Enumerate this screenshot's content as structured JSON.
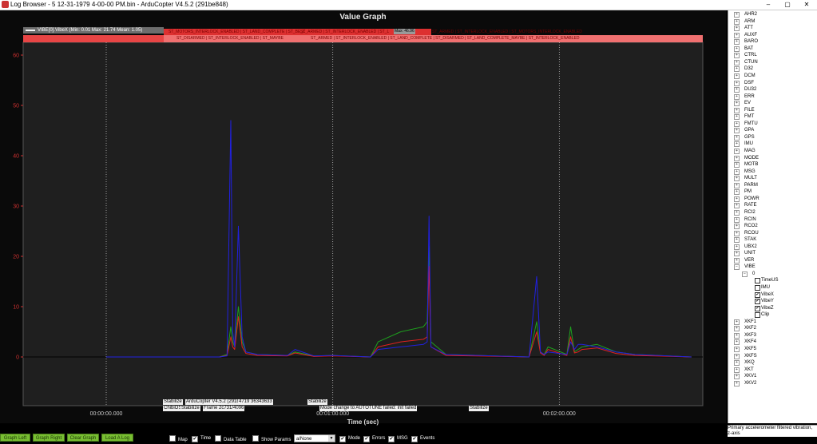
{
  "window": {
    "title": "Log Browser - 5 12-31-1979 4-00-00 PM.bin - ArduCopter V4.5.2 (291be848)",
    "minimize": "–",
    "maximize": "▢",
    "close": "✕"
  },
  "graph": {
    "title": "Value Graph",
    "legend": "VIBE[0].VibeX  (Min: 0.01 Max: 21.74 Mean: 1.05)",
    "x_axis_label": "Time (sec)",
    "x_ticks": [
      "00:00:00.000",
      "00:01:00.000",
      "00:02:00.000"
    ],
    "y_ticks": [
      "0",
      "10",
      "20",
      "30",
      "40",
      "50",
      "60"
    ],
    "top_bar_snippets": [
      "ST_MOTORS_INTERLOCK_ENABLED | ST_LAND_COMPLETE | ST_BE_DISARMED",
      "ST_ARMED | ST_INTERLOCK_ENABLED | ST_LAND_COMPLETE_MAYBE",
      "ST_ARMED | ST_INTERLOCK_ENABLED | ST_MOTORS_INTERLOCK_ENABLED",
      "ST_DISARMED | ST_INTERLOCK_ENABLED | ST_MAYBE",
      "ST_ARMED | ST_INTERLOCK_ENABLED | ST_LAND_COMPLETE | ST_DISARMED | ST_LAND_COMPLETE_MAYBE | ST_INTERLOCK_ENABLED"
    ],
    "mid_bar_overlay": "Max: 46.96",
    "annotations": {
      "a1": "Stabilize",
      "a2": "ArduCopter V4.5.2 (291be848)",
      "a3": "4719 36343633",
      "a4": "ChibiOS",
      "a5": "Stabilize",
      "a6": "Frame",
      "a7": "2c731/4096",
      "a8": "Stabilize",
      "a9": "Mode change to AUTOTUNE failed: init failed",
      "a10": "Stabilize"
    }
  },
  "chart_data": {
    "type": "line",
    "xlabel": "Time (sec)",
    "ylabel": "",
    "ylim": [
      0,
      60
    ],
    "x_tick_labels": [
      "00:00:00.000",
      "00:01:00.000",
      "00:02:00.000"
    ],
    "series": [
      {
        "name": "VIBE[0].VibeX",
        "color": "#1fa01f",
        "x": [
          0,
          30,
          32,
          33,
          33.5,
          34,
          35,
          36,
          37,
          40,
          48,
          50,
          55,
          60,
          70,
          72,
          78,
          84,
          85,
          85.5,
          86,
          90,
          112,
          114,
          115,
          116,
          117,
          122,
          123,
          124,
          125,
          126,
          130,
          135,
          140,
          155
        ],
        "y": [
          0,
          0,
          0.5,
          6,
          3,
          2,
          10,
          3,
          1,
          0.5,
          0.3,
          1,
          0.2,
          0.3,
          0,
          3,
          5,
          6,
          7,
          22,
          3,
          0.5,
          0,
          7,
          1,
          0.5,
          2,
          0.5,
          6,
          1,
          1.5,
          2,
          2.5,
          1,
          0.5,
          0
        ]
      },
      {
        "name": "VIBE[0].VibeY",
        "color": "#e02020",
        "x": [
          0,
          30,
          32,
          33,
          33.5,
          34,
          35,
          36,
          37,
          40,
          48,
          50,
          55,
          60,
          70,
          72,
          78,
          84,
          85,
          85.5,
          86,
          90,
          112,
          114,
          115,
          116,
          117,
          122,
          123,
          124,
          125,
          126,
          130,
          135,
          140,
          155
        ],
        "y": [
          0,
          0,
          0.3,
          4,
          2,
          1.5,
          8,
          2,
          0.7,
          0.3,
          0.2,
          0.8,
          0.1,
          0.2,
          0,
          2,
          3,
          3.5,
          4,
          18,
          2,
          0.3,
          0,
          5,
          0.8,
          0.3,
          1.5,
          0.3,
          4,
          0.8,
          1,
          1.5,
          1.8,
          0.7,
          0.3,
          0
        ]
      },
      {
        "name": "VIBE[0].VibeZ",
        "color": "#2020e0",
        "x": [
          0,
          30,
          32,
          33,
          33.5,
          34,
          35,
          36,
          37,
          40,
          48,
          50,
          55,
          60,
          70,
          72,
          78,
          84,
          85,
          85.5,
          86,
          90,
          112,
          114,
          115,
          116,
          117,
          122,
          123,
          124,
          125,
          126,
          130,
          135,
          140,
          155
        ],
        "y": [
          0,
          0,
          0.2,
          47,
          5,
          2,
          26,
          4,
          1,
          0.5,
          0.3,
          1.5,
          0.2,
          0.3,
          0,
          1.5,
          2,
          2.5,
          3,
          28,
          2,
          0.5,
          0,
          16,
          1,
          0.5,
          1,
          0.5,
          3,
          1.5,
          2.5,
          2.5,
          2,
          1,
          0.5,
          0
        ]
      }
    ],
    "grid": true
  },
  "tree": {
    "items": [
      {
        "label": "AHR2",
        "expander": "+"
      },
      {
        "label": "ARM",
        "expander": "+"
      },
      {
        "label": "ATT",
        "expander": "+"
      },
      {
        "label": "AUXF",
        "expander": "+"
      },
      {
        "label": "BARO",
        "expander": "+"
      },
      {
        "label": "BAT",
        "expander": "+"
      },
      {
        "label": "CTRL",
        "expander": "+"
      },
      {
        "label": "CTUN",
        "expander": "+"
      },
      {
        "label": "D32",
        "expander": "+"
      },
      {
        "label": "DCM",
        "expander": "+"
      },
      {
        "label": "DSF",
        "expander": "+"
      },
      {
        "label": "DU32",
        "expander": "+"
      },
      {
        "label": "ERR",
        "expander": "+"
      },
      {
        "label": "EV",
        "expander": "+"
      },
      {
        "label": "FILE",
        "expander": "+"
      },
      {
        "label": "FMT",
        "expander": "+"
      },
      {
        "label": "FMTU",
        "expander": "+"
      },
      {
        "label": "GPA",
        "expander": "+"
      },
      {
        "label": "GPS",
        "expander": "+"
      },
      {
        "label": "IMU",
        "expander": "+"
      },
      {
        "label": "MAG",
        "expander": "+"
      },
      {
        "label": "MODE",
        "expander": "+"
      },
      {
        "label": "MOTB",
        "expander": "+"
      },
      {
        "label": "MSG",
        "expander": "+"
      },
      {
        "label": "MULT",
        "expander": "+"
      },
      {
        "label": "PARM",
        "expander": "+"
      },
      {
        "label": "PM",
        "expander": "+"
      },
      {
        "label": "POWR",
        "expander": "+"
      },
      {
        "label": "RATE",
        "expander": "+"
      },
      {
        "label": "RCI2",
        "expander": "+"
      },
      {
        "label": "RCIN",
        "expander": "+"
      },
      {
        "label": "RCO2",
        "expander": "+"
      },
      {
        "label": "RCOU",
        "expander": "+"
      },
      {
        "label": "STAK",
        "expander": "+"
      },
      {
        "label": "UBX2",
        "expander": "+"
      },
      {
        "label": "UNIT",
        "expander": "+"
      },
      {
        "label": "VER",
        "expander": "+"
      },
      {
        "label": "VIBE",
        "expander": "−"
      }
    ],
    "vibe_instance": {
      "label": "0",
      "expander": "−"
    },
    "vibe_fields": [
      {
        "label": "TimeUS",
        "checked": ""
      },
      {
        "label": "IMU",
        "checked": ""
      },
      {
        "label": "VibeX",
        "checked": "✔"
      },
      {
        "label": "VibeY",
        "checked": "✔"
      },
      {
        "label": "VibeZ",
        "checked": "✔"
      },
      {
        "label": "Clip",
        "checked": ""
      }
    ],
    "tail_items": [
      {
        "label": "XKF1",
        "expander": "+"
      },
      {
        "label": "XKF2",
        "expander": "+"
      },
      {
        "label": "XKF3",
        "expander": "+"
      },
      {
        "label": "XKF4",
        "expander": "+"
      },
      {
        "label": "XKF5",
        "expander": "+"
      },
      {
        "label": "XKFS",
        "expander": "+"
      },
      {
        "label": "XKQ",
        "expander": "+"
      },
      {
        "label": "XKT",
        "expander": "+"
      },
      {
        "label": "XKV1",
        "expander": "+"
      },
      {
        "label": "XKV2",
        "expander": "+"
      }
    ]
  },
  "status": {
    "description": "Primary accelerometer filtered vibration, z-axis"
  },
  "bottom": {
    "graph_left": "Graph Left",
    "graph_right": "Graph Right",
    "clear_graph": "Clear Graph",
    "load_log": "Load A Log",
    "map": {
      "label": "Map",
      "checked": ""
    },
    "time": {
      "label": "Time",
      "checked": "✔"
    },
    "data_table": {
      "label": "Data Table",
      "checked": ""
    },
    "show_params": {
      "label": "Show Params",
      "checked": ""
    },
    "combo_value": "a/None",
    "mode": {
      "label": "Mode",
      "checked": "✔"
    },
    "errors": {
      "label": "Errors",
      "checked": "✔"
    },
    "msg": {
      "label": "MSG",
      "checked": "✔"
    },
    "events": {
      "label": "Events",
      "checked": "✔"
    }
  }
}
